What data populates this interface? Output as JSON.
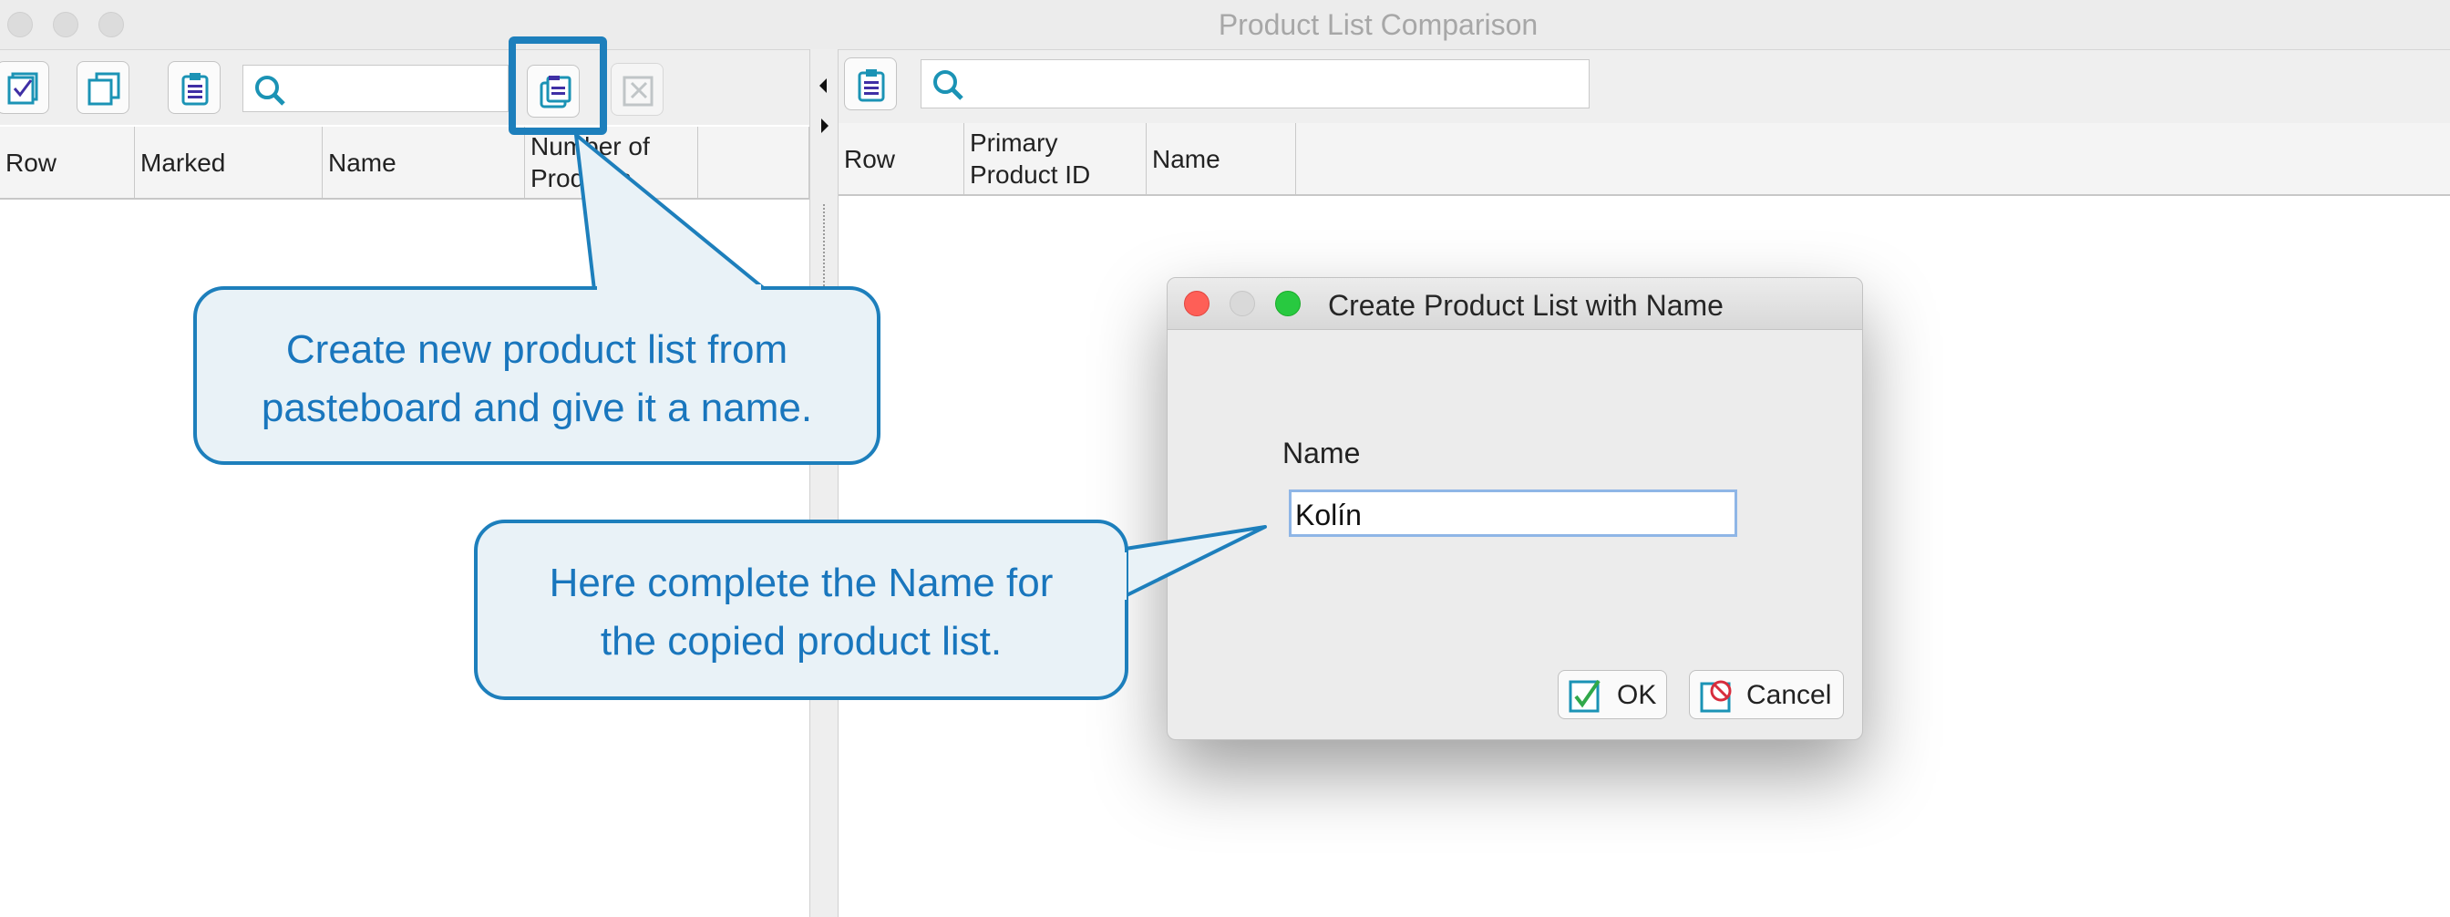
{
  "window": {
    "title": "Product List Comparison"
  },
  "left_panel": {
    "columns": [
      "Row",
      "Marked",
      "Name",
      "Number of Products"
    ],
    "toolbar": {
      "buttons": [
        "checklist-icon",
        "copy-icon",
        "clipboard-list-icon",
        "search-icon",
        "paste-list-icon",
        "delete-icon"
      ],
      "search": {
        "value": ""
      }
    }
  },
  "right_panel": {
    "columns": [
      "Row",
      "Primary Product ID",
      "Name"
    ],
    "toolbar": {
      "buttons": [
        "clipboard-list-icon",
        "search-icon"
      ],
      "search": {
        "value": ""
      }
    }
  },
  "dialog": {
    "title": "Create Product List with Name",
    "field_label": "Name",
    "field_value": "Kolín",
    "ok_label": "OK",
    "cancel_label": "Cancel"
  },
  "callouts": {
    "top": [
      "Create new product list from",
      "pasteboard and give it a name."
    ],
    "bottom": [
      "Here complete the Name for",
      "the copied product list."
    ]
  },
  "colors": {
    "callout_border": "#1d7fbc",
    "callout_text": "#1976bd",
    "callout_fill": "#e9f2f7"
  }
}
